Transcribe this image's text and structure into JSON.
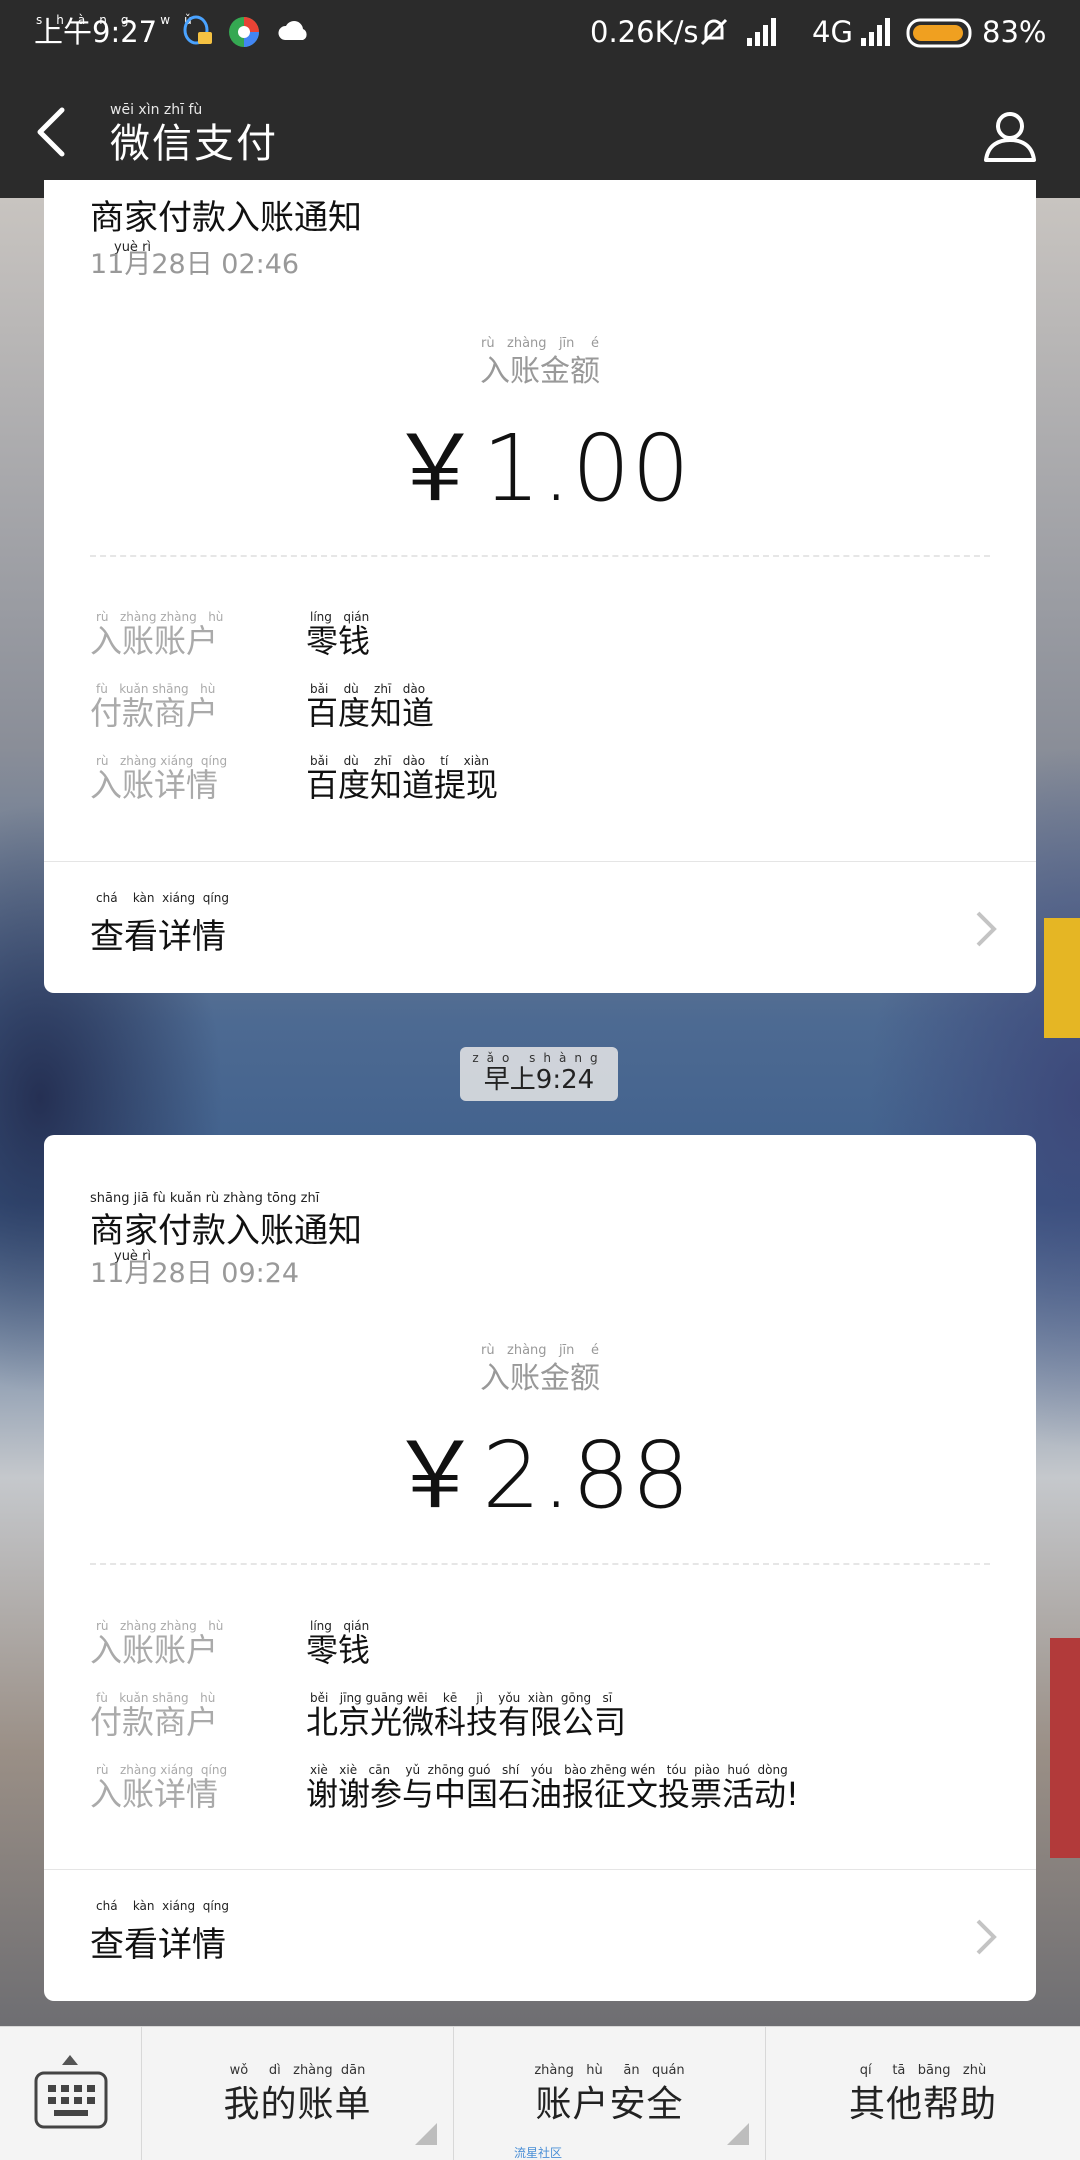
{
  "status_bar": {
    "time_ruby": "shàng wǔ",
    "time": "上午9:27",
    "net_speed": "0.26K/s",
    "network": "4G",
    "battery": "83%",
    "colors": {
      "battery": "#f0a020"
    }
  },
  "header": {
    "title_ruby": "wēi   xìn   zhī   fù",
    "title": "微信支付",
    "back_icon": "chevron-left-icon",
    "profile_icon": "person-icon"
  },
  "cards": [
    {
      "title": "商家付款入账通知",
      "date_ruby": "yuè          rì",
      "date": "11月28日  02:46",
      "amount_ruby": "rù   zhàng   jīn    é",
      "amount_label": "入账金额",
      "amount": "￥1.00",
      "rows": [
        {
          "label_ruby": "rù   zhàng zhàng   hù",
          "label": "入账账户",
          "value_ruby": "líng   qián",
          "value": "零钱"
        },
        {
          "label_ruby": "fù   kuǎn shāng   hù",
          "label": "付款商户",
          "value_ruby": "bǎi    dù    zhī   dào",
          "value": "百度知道"
        },
        {
          "label_ruby": "rù   zhàng xiáng  qíng",
          "label": "入账详情",
          "value_ruby": "bǎi    dù    zhī   dào    tí    xiàn",
          "value": "百度知道提现"
        }
      ],
      "footer_ruby": "chá    kàn  xiáng  qíng",
      "footer": "查看详情"
    },
    {
      "title_ruby": "shāng   jiā    fù   kuǎn   rù   zhàng  tōng   zhī",
      "title": "商家付款入账通知",
      "date_ruby": "yuè          rì",
      "date": "11月28日  09:24",
      "amount_ruby": "rù   zhàng   jīn    é",
      "amount_label": "入账金额",
      "amount": "￥2.88",
      "rows": [
        {
          "label_ruby": "rù   zhàng zhàng   hù",
          "label": "入账账户",
          "value_ruby": "líng   qián",
          "value": "零钱"
        },
        {
          "label_ruby": "fù   kuǎn shāng   hù",
          "label": "付款商户",
          "value_ruby": "běi   jīng guāng wēi    kē     jì    yǒu  xiàn  gōng   sī",
          "value": "北京光微科技有限公司"
        },
        {
          "label_ruby": "rù   zhàng xiáng  qíng",
          "label": "入账详情",
          "value_ruby": "xiè   xiè   cān    yǔ  zhōng guó   shí   yóu   bào zhēng wén   tóu  piào  huó  dòng",
          "value": "谢谢参与中国石油报征文投票活动!"
        }
      ],
      "footer_ruby": "chá    kàn  xiáng  qíng",
      "footer": "查看详情"
    }
  ],
  "time_pill": {
    "ruby": "zǎo shàng",
    "text": "早上9:24"
  },
  "bottom_bar": {
    "keyboard_icon": "keyboard-icon",
    "menus": [
      {
        "ruby": "wǒ     dì   zhàng  dān",
        "label": "我的账单"
      },
      {
        "ruby": "zhàng   hù     ān   quán",
        "label": "账户安全",
        "tag": "流星社区"
      },
      {
        "ruby": "qí     tā   bāng   zhù",
        "label": "其他帮助"
      }
    ]
  }
}
